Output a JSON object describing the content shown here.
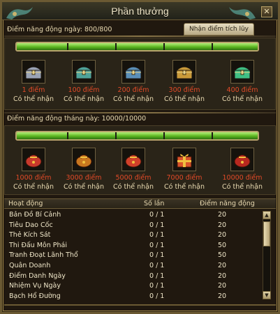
{
  "window": {
    "title": "Phần thưởng",
    "close_symbol": "✕"
  },
  "daily": {
    "label": "Điểm năng động ngày: 800/800",
    "progress": 1.0,
    "claim_tab": "Nhận điểm tích lũy",
    "rewards": [
      {
        "points": "1 điểm",
        "status": "Có thể nhận",
        "icon": "silver-chest-icon",
        "color": "#9aa3b5"
      },
      {
        "points": "100 điểm",
        "status": "Có thể nhận",
        "icon": "teal-chest-icon",
        "color": "#4fa39a"
      },
      {
        "points": "200 điểm",
        "status": "Có thể nhận",
        "icon": "blue-chest-icon",
        "color": "#5a8fb8"
      },
      {
        "points": "300 điểm",
        "status": "Có thể nhận",
        "icon": "gold-chest-icon",
        "color": "#c99a3a"
      },
      {
        "points": "400 điểm",
        "status": "Có thể nhận",
        "icon": "jade-chest-icon",
        "color": "#3fbf84"
      }
    ]
  },
  "monthly": {
    "label": "Điểm năng động tháng này: 10000/10000",
    "progress": 1.0,
    "rewards": [
      {
        "points": "1000 điểm",
        "status": "Có thể nhận",
        "icon": "red-pouch-icon",
        "color": "#c8392c"
      },
      {
        "points": "3000 điểm",
        "status": "Có thể nhận",
        "icon": "orange-pouch-icon",
        "color": "#c9771f"
      },
      {
        "points": "5000 điểm",
        "status": "Có thể nhận",
        "icon": "red-bag-icon",
        "color": "#d0402a"
      },
      {
        "points": "7000 điểm",
        "status": "Có thể nhận",
        "icon": "gift-box-icon",
        "color": "#d8532a"
      },
      {
        "points": "10000 điểm",
        "status": "Có thể nhận",
        "icon": "red-sack-icon",
        "color": "#b8281f"
      }
    ]
  },
  "table": {
    "headers": {
      "activity": "Hoạt động",
      "count": "Số lần",
      "points": "Điểm năng động"
    },
    "rows": [
      {
        "name": "Bản Đồ Bí Cảnh",
        "count": "0 / 1",
        "points": "20"
      },
      {
        "name": "Tiêu Dao Cốc",
        "count": "0 / 1",
        "points": "20"
      },
      {
        "name": "Thẻ Kích Sát",
        "count": "0 / 1",
        "points": "20"
      },
      {
        "name": "Thi Đấu Môn Phái",
        "count": "0 / 1",
        "points": "50"
      },
      {
        "name": "Tranh Đoạt Lãnh Thổ",
        "count": "0 / 1",
        "points": "50"
      },
      {
        "name": "Quân Doanh",
        "count": "0 / 1",
        "points": "20"
      },
      {
        "name": "Điểm Danh Ngày",
        "count": "0 / 1",
        "points": "20"
      },
      {
        "name": "Nhiệm Vụ Ngày",
        "count": "0 / 1",
        "points": "20"
      },
      {
        "name": "Bạch Hổ Đường",
        "count": "0 / 1",
        "points": "20"
      }
    ]
  },
  "scrollbar": {
    "up_symbol": "▲",
    "down_symbol": "▼"
  }
}
